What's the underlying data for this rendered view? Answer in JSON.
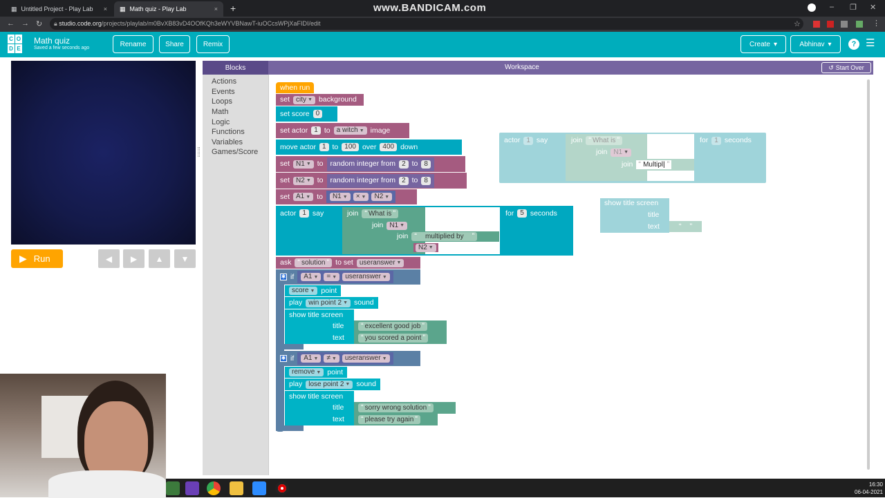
{
  "browser": {
    "tabs": [
      {
        "label": "Untitled Project - Play Lab",
        "close": "×"
      },
      {
        "label": "Math quiz - Play Lab",
        "close": "×"
      }
    ],
    "new_tab": "+",
    "watermark": "www.BANDICAM.com",
    "url_host": "studio.code.org",
    "url_path": "/projects/playlab/m0BvXB83vD4OOfKQh3eWYVBNawT-iuOCcsWPjXaFIDI/edit"
  },
  "header": {
    "logo_letters": [
      "C",
      "O",
      "D",
      "E"
    ],
    "project_title": "Math quiz",
    "saved_status": "Saved a few seconds ago",
    "rename_label": "Rename",
    "share_label": "Share",
    "remix_label": "Remix",
    "create_label": "Create",
    "user_label": "Abhinav",
    "help_label": "?"
  },
  "stage": {
    "run_label": "Run"
  },
  "workspace_header": {
    "blocks_label": "Blocks",
    "workspace_label": "Workspace",
    "start_over_label": "Start Over"
  },
  "toolbox": {
    "categories": [
      "Actions",
      "Events",
      "Loops",
      "Math",
      "Logic",
      "Functions",
      "Variables",
      "Games/Score"
    ]
  },
  "program": {
    "when_run": "when run",
    "set_bg": {
      "kw1": "set",
      "value": "city",
      "kw2": "background"
    },
    "set_score": {
      "kw": "set score",
      "value": "0"
    },
    "set_actor": {
      "kw1": "set actor",
      "num": "1",
      "kw2": "to",
      "value": "a witch",
      "kw3": "image"
    },
    "move_actor": {
      "kw1": "move actor",
      "num": "1",
      "kw2": "to",
      "dist": "100",
      "kw3": "over",
      "time": "400",
      "dir": "down"
    },
    "set_n1": {
      "kw1": "set",
      "var": "N1",
      "kw2": "to",
      "fn": "random integer from",
      "from": "2",
      "kw3": "to",
      "to": "8"
    },
    "set_n2": {
      "kw1": "set",
      "var": "N2",
      "kw2": "to",
      "fn": "random integer from",
      "from": "2",
      "kw3": "to",
      "to": "8"
    },
    "set_a1": {
      "kw1": "set",
      "var": "A1",
      "kw2": "to",
      "left": "N1",
      "op": "×",
      "right": "N2"
    },
    "say": {
      "kw1": "actor",
      "num": "1",
      "kw2": "say",
      "join": "join",
      "text1": "What is",
      "var1": "N1",
      "text2": "multiplied by",
      "var2": "N2",
      "kw3": "for",
      "secs": "5",
      "kw4": "seconds"
    },
    "ask": {
      "kw1": "ask",
      "text": "solution",
      "kw2": "to set",
      "var": "useranswer"
    },
    "if1": {
      "kw": "if",
      "left": "A1",
      "op": "=",
      "right": "useranswer",
      "score_action": "score",
      "score_kw": "point",
      "play_kw": "play",
      "sound": "win point 2",
      "sound_kw": "sound",
      "title_screen": "show title screen",
      "title_kw": "title",
      "title": "excellent good job",
      "text_kw": "text",
      "text": "you scored a point"
    },
    "if2": {
      "kw": "if",
      "left": "A1",
      "op": "≠",
      "right": "useranswer",
      "score_action": "remove",
      "score_kw": "point",
      "play_kw": "play",
      "sound": "lose point 2",
      "sound_kw": "sound",
      "title_screen": "show title screen",
      "title_kw": "title",
      "title": "sorry wrong solution",
      "text_kw": "text",
      "text": "please try again"
    }
  },
  "floating": {
    "say_copy": {
      "kw1": "actor",
      "num": "1",
      "kw2": "say",
      "join": "join",
      "text1": "What is",
      "var1": "N1",
      "text2": "Multipl",
      "kw3": "for",
      "secs": "1",
      "kw4": "seconds"
    },
    "title_screen": {
      "label": "show title screen",
      "title_kw": "title",
      "text_kw": "text"
    }
  },
  "taskbar": {
    "time": "16:30",
    "date": "06-04-2021"
  }
}
